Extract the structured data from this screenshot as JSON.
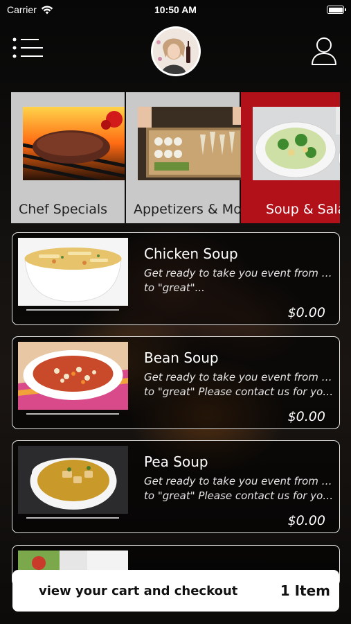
{
  "status_bar": {
    "carrier": "Carrier",
    "time": "10:50 AM",
    "icons": [
      "wifi-icon",
      "battery-icon"
    ]
  },
  "header": {
    "menu_icon": "list-menu-icon",
    "avatar_icon": "restaurant-logo-avatar",
    "profile_icon": "user-profile-icon"
  },
  "categories": [
    {
      "label": "Chef Specials",
      "active": false,
      "image": "grilled-steak"
    },
    {
      "label": "Appetizers & More",
      "active": false,
      "image": "appetizer-platter"
    },
    {
      "label": "Soup & Salad",
      "active": true,
      "image": "salad-and-soup"
    }
  ],
  "menu_items": [
    {
      "name": "Chicken Soup",
      "desc_line1": "Get ready to take you event from good",
      "desc_line2": "to \"great\"...",
      "price": "$0.00",
      "image": "chicken-noodle-soup"
    },
    {
      "name": "Bean Soup",
      "desc_line1": "Get ready to take you event from good",
      "desc_line2": "to \"great\" Please contact us for your...",
      "price": "$0.00",
      "image": "bean-soup"
    },
    {
      "name": "Pea Soup",
      "desc_line1": "Get ready to take you event from good",
      "desc_line2": "to \"great\" Please contact us for your...",
      "price": "$0.00",
      "image": "pea-soup"
    }
  ],
  "cart": {
    "label": "view your cart and checkout",
    "count": "1 Item"
  },
  "colors": {
    "accent_red": "#b2111a",
    "category_bg": "#c9c9c9",
    "card_border": "#e6e6e6"
  }
}
